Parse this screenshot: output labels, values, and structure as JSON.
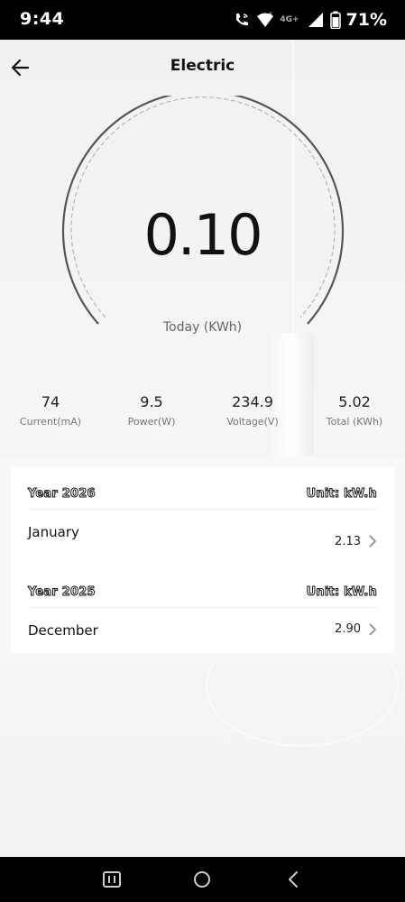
{
  "status_bar": {
    "time": "9:44",
    "network": "4G+",
    "battery_percent": "71%"
  },
  "header": {
    "title": "Electric"
  },
  "gauge": {
    "value": "0.10",
    "label": "Today (KWh)"
  },
  "stats": [
    {
      "value": "74",
      "label": "Current(mA)"
    },
    {
      "value": "9.5",
      "label": "Power(W)"
    },
    {
      "value": "234.9",
      "label": "Voltage(V)"
    },
    {
      "value": "5.02",
      "label": "Total (KWh)"
    }
  ],
  "history": [
    {
      "year_label": "Year 2026",
      "unit_label": "Unit: kW.h",
      "month": "January",
      "value": "2.13"
    },
    {
      "year_label": "Year 2025",
      "unit_label": "Unit: kW.h",
      "month": "December",
      "value": "2.90"
    }
  ],
  "icons": {
    "back": "arrow-left-icon",
    "chevron": "chevron-right-icon",
    "recents": "recents-icon",
    "home": "home-icon",
    "nav_back": "chevron-left-icon"
  },
  "colors": {
    "status_bar_bg": "#000000",
    "gauge_stroke": "#555555",
    "background": "#f3f3f3"
  }
}
